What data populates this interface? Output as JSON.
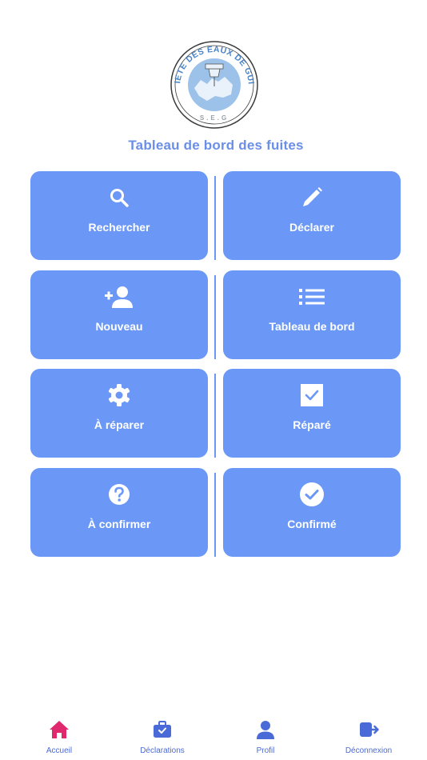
{
  "header": {
    "logo_text_top": "SOCIETE DES EAUX DE GUINEE",
    "logo_text_bottom": "S.E.G",
    "title": "Tableau de bord des fuites"
  },
  "colors": {
    "tile": "#6b98f6",
    "title": "#6b8fe8",
    "nav_active": "#e0286f",
    "nav_inactive": "#4a6ad8"
  },
  "tiles": [
    {
      "label": "Rechercher",
      "icon": "search-icon"
    },
    {
      "label": "Déclarer",
      "icon": "pencil-icon"
    },
    {
      "label": "Nouveau",
      "icon": "add-user-icon"
    },
    {
      "label": "Tableau de bord",
      "icon": "list-icon"
    },
    {
      "label": "À réparer",
      "icon": "gear-icon"
    },
    {
      "label": "Réparé",
      "icon": "checkbox-icon"
    },
    {
      "label": "À confirmer",
      "icon": "question-circle-icon"
    },
    {
      "label": "Confirmé",
      "icon": "check-circle-icon"
    }
  ],
  "nav": [
    {
      "label": "Accueil",
      "icon": "home-icon",
      "active": true
    },
    {
      "label": "Déclarations",
      "icon": "briefcase-icon",
      "active": false
    },
    {
      "label": "Profil",
      "icon": "user-icon",
      "active": false
    },
    {
      "label": "Déconnexion",
      "icon": "logout-icon",
      "active": false
    }
  ]
}
